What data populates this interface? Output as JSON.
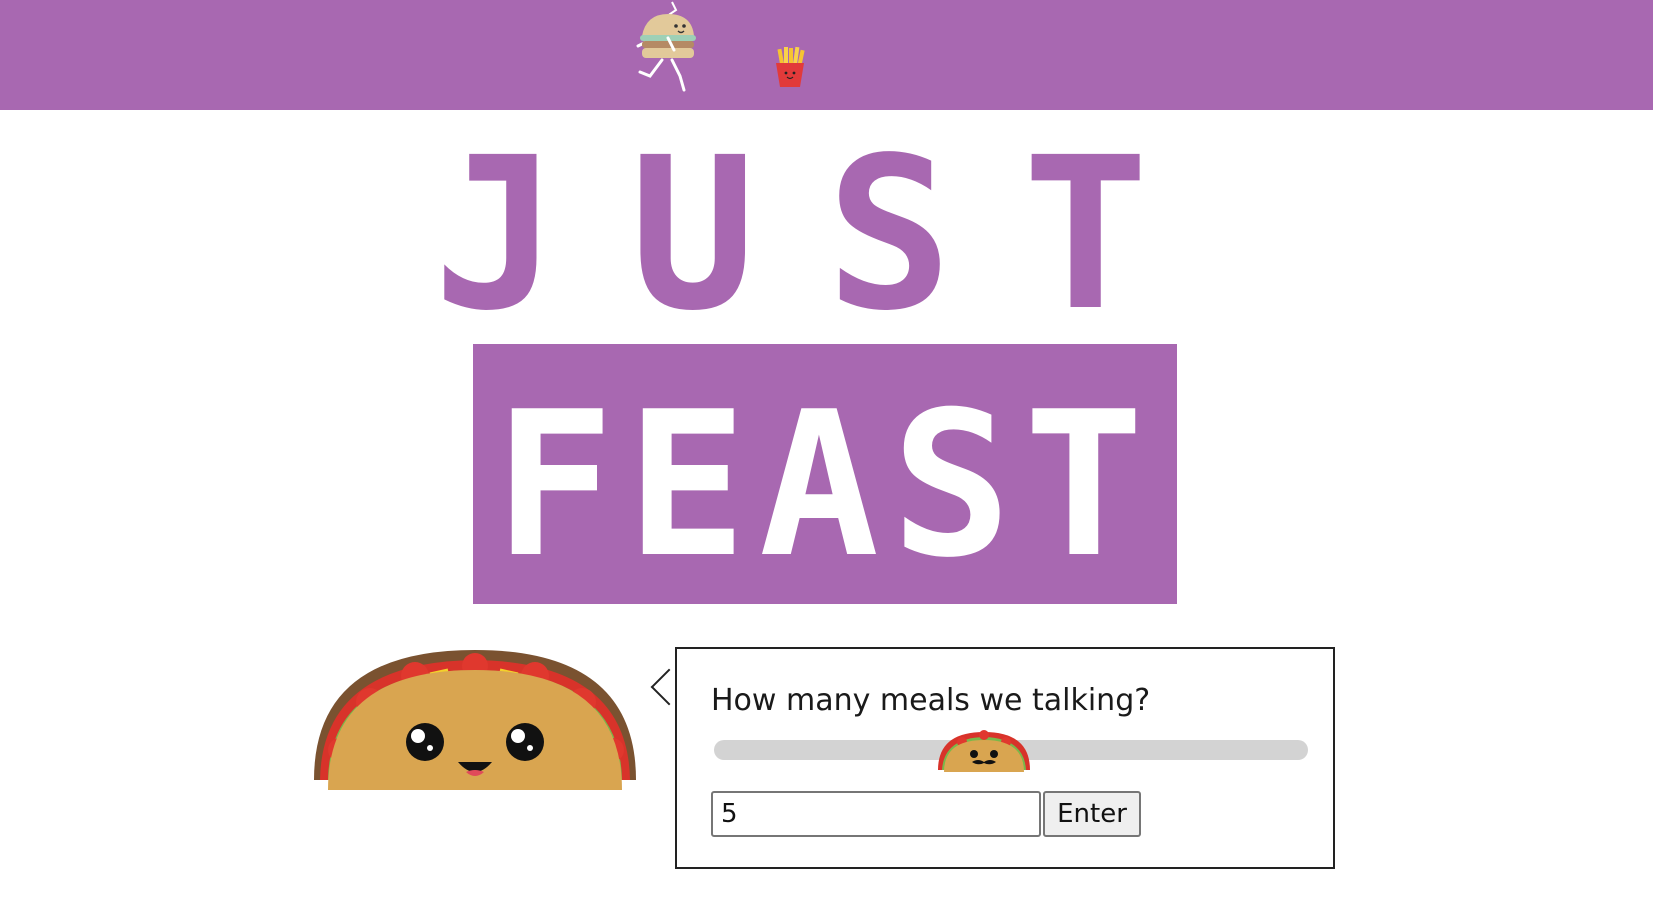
{
  "brand": {
    "line1": "JUST",
    "line2": "FEAST",
    "color": "#a868b1",
    "mascot_icon": "running-burger-icon",
    "side_icon": "fries-icon",
    "main_mascot": "happy-taco-icon"
  },
  "prompt": {
    "question": "How many meals we talking?",
    "slider_thumb_icon": "mustache-taco-icon",
    "slider_value": 0.4,
    "input_value": "5",
    "enter_label": "Enter"
  }
}
